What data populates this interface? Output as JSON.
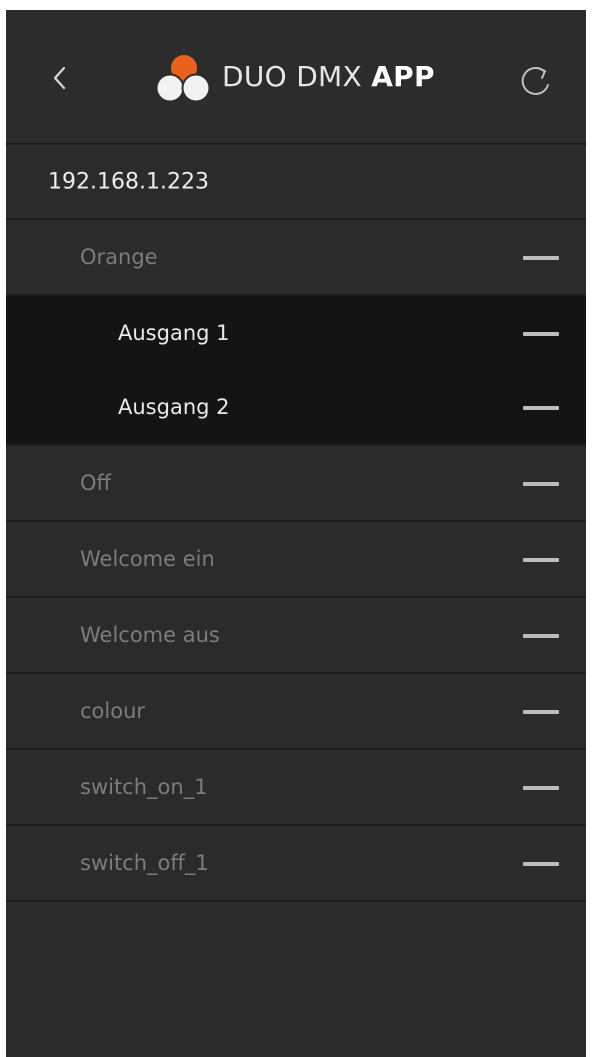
{
  "header": {
    "title_light": "DUO DMX",
    "title_bold": "APP",
    "back_icon": "chevron-left-icon",
    "refresh_icon": "refresh-icon",
    "logo_icon": "duo-dmx-logo"
  },
  "colors": {
    "background": "#2b2b2b",
    "header": "#2c2c2c",
    "expanded_background": "#141414",
    "accent": "#e8621c",
    "group_text": "#7c7c7c",
    "item_text": "#e9e9e9"
  },
  "device": {
    "ip": "192.168.1.223"
  },
  "groups": [
    {
      "label": "Orange",
      "expanded": true,
      "children": [
        "Ausgang 1",
        "Ausgang 2"
      ]
    },
    {
      "label": "Off"
    },
    {
      "label": "Welcome ein"
    },
    {
      "label": "Welcome aus"
    },
    {
      "label": "colour"
    },
    {
      "label": "switch_on_1"
    },
    {
      "label": "switch_off_1"
    }
  ]
}
